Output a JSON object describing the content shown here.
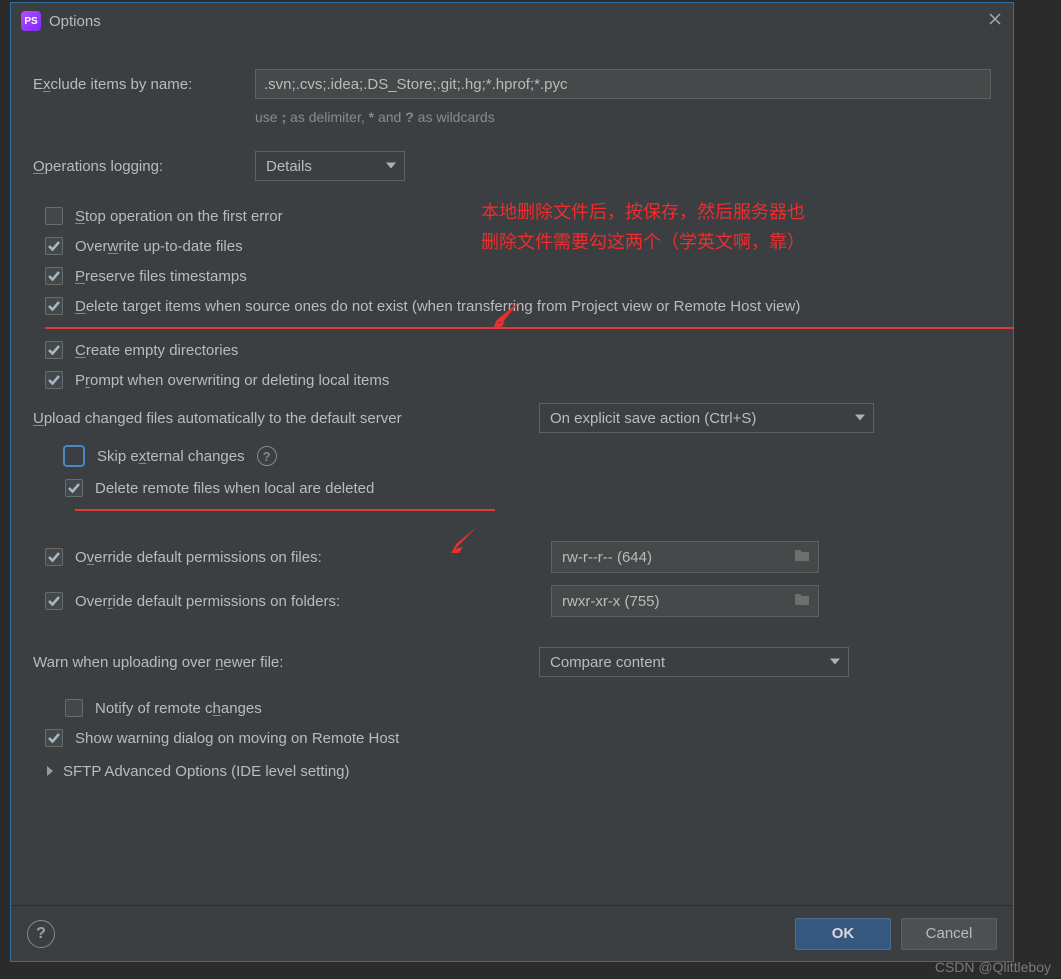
{
  "window": {
    "title": "Options"
  },
  "exclude": {
    "label_pre": "E",
    "label_u": "x",
    "label_post": "clude items by name:",
    "value": ".svn;.cvs;.idea;.DS_Store;.git;.hg;*.hprof;*.pyc",
    "hint_pre": "use ",
    "hint_s1": ";",
    "hint_mid1": " as delimiter, ",
    "hint_s2": "*",
    "hint_mid2": " and ",
    "hint_s3": "?",
    "hint_post": " as wildcards"
  },
  "oplog": {
    "label_u": "O",
    "label_post": "perations logging:",
    "value": "Details"
  },
  "checks": {
    "stop": {
      "checked": false,
      "pre": "",
      "u": "S",
      "post": "top operation on the first error"
    },
    "overwrite": {
      "checked": true,
      "pre": "Over",
      "u": "w",
      "post": "rite up-to-date files"
    },
    "preserve": {
      "checked": true,
      "pre": "",
      "u": "P",
      "post": "reserve files timestamps"
    },
    "deleteTgt": {
      "checked": true,
      "pre": "",
      "u": "D",
      "post": "elete target items when source ones do not exist (when transferring from Project view or Remote Host view)"
    },
    "createDir": {
      "checked": true,
      "pre": "",
      "u": "C",
      "post": "reate empty directories"
    },
    "prompt": {
      "checked": true,
      "pre": "P",
      "u": "r",
      "post": "ompt when overwriting or deleting local items"
    },
    "skipExt": {
      "checked": false,
      "pre": "Skip e",
      "u": "x",
      "post": "ternal changes"
    },
    "delRemote": {
      "checked": true,
      "label": "Delete remote files when local are deleted"
    },
    "overrideF": {
      "checked": true,
      "pre": "O",
      "u": "v",
      "post": "erride default permissions on files:"
    },
    "overrideD": {
      "checked": true,
      "pre": "Over",
      "u": "r",
      "post": "ide default permissions on folders:"
    },
    "notify": {
      "checked": false,
      "pre": "Notify of remote c",
      "u": "h",
      "post": "anges"
    },
    "showWarn": {
      "checked": true,
      "label": "Show warning dialog on moving on Remote Host"
    }
  },
  "upload": {
    "label_u": "U",
    "label_post": "pload changed files automatically to the default server",
    "value": "On explicit save action (Ctrl+S)"
  },
  "perms": {
    "files": "rw-r--r-- (644)",
    "folders": "rwxr-xr-x (755)"
  },
  "warn": {
    "label_pre": "Warn when uploading over ",
    "label_u": "n",
    "label_post": "ewer file:",
    "value": "Compare content"
  },
  "expand": {
    "label": "SFTP Advanced Options (IDE level setting)"
  },
  "annotation": {
    "line1": "本地删除文件后，按保存，然后服务器也",
    "line2": "删除文件需要勾这两个（学英文啊，靠）"
  },
  "footer": {
    "ok": "OK",
    "cancel": "Cancel"
  },
  "watermark": "CSDN @Qlittleboy"
}
